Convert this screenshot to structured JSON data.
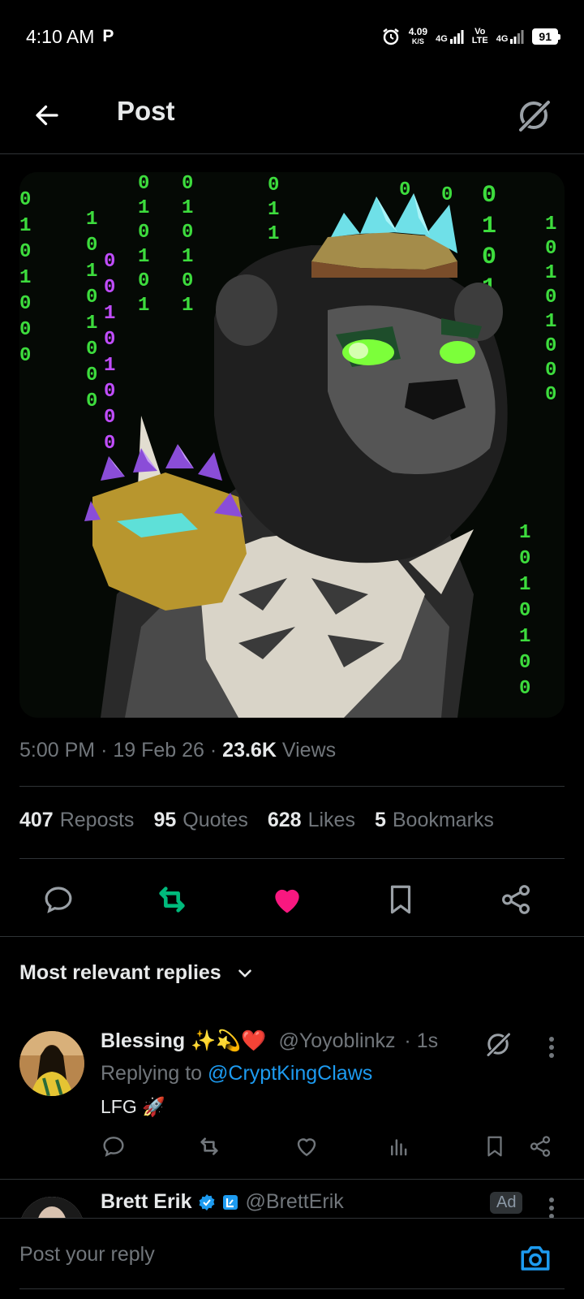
{
  "status_bar": {
    "time": "4:10 AM",
    "carrier_icon": "P",
    "speed_value": "4.09",
    "speed_unit": "K/S",
    "net1": "4G",
    "net2_top": "Vo",
    "net2_bottom": "LTE",
    "net3": "4G",
    "battery": "91"
  },
  "header": {
    "title": "Post",
    "back_icon": "arrow-left-icon",
    "grok_icon": "grok-icon"
  },
  "post": {
    "image_binary_left": [
      "0",
      "1",
      "0",
      "1",
      "0",
      "0",
      "0"
    ],
    "time": "5:00 PM",
    "date": "19 Feb 26",
    "views_count": "23.6K",
    "views_label": "Views",
    "stats": {
      "reposts_count": "407",
      "reposts_label": "Reposts",
      "quotes_count": "95",
      "quotes_label": "Quotes",
      "likes_count": "628",
      "likes_label": "Likes",
      "bookmarks_count": "5",
      "bookmarks_label": "Bookmarks"
    },
    "liked": true,
    "reposted": true
  },
  "colors": {
    "accent_blue": "#1d9bf0",
    "like_pink": "#f91880",
    "repost_green": "#00ba7c",
    "matrix_green": "#3ddc3d",
    "matrix_purple": "#c14dff"
  },
  "sort": {
    "label": "Most relevant replies"
  },
  "replies": [
    {
      "name": "Blessing ✨💫❤️",
      "handle": "@Yoyoblinkz",
      "time": "· 1s",
      "replying_label": "Replying to",
      "replying_handle": "@CryptKingClaws",
      "text": "LFG 🚀"
    },
    {
      "name": "Brett Erik",
      "handle": "@BrettErik",
      "badge": "Ad"
    }
  ],
  "composer": {
    "placeholder": "Post your reply"
  }
}
